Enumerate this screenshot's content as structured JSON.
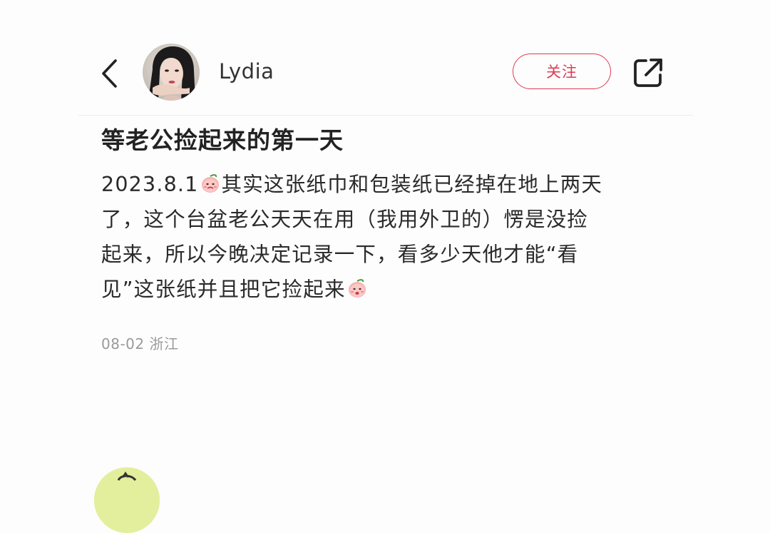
{
  "header": {
    "back_icon": "chevron-left-icon",
    "username": "Lydia",
    "follow_label": "关注",
    "share_icon": "share-external-icon"
  },
  "post": {
    "title": "等老公捡起来的第一天",
    "body_lines": [
      {
        "before": "2023.8.1",
        "emoji": "peach-face-emoji",
        "after": "其实这张纸巾和包装纸已经掉在地上两天"
      },
      {
        "text": "了，这个台盆老公天天在用（我用外卫的）愣是没捡"
      },
      {
        "text": "起来，所以今晚决定记录一下，看多少天他才能“看"
      },
      {
        "before": "见”这张纸并且把它捡起来",
        "emoji": "peach-face-emoji"
      }
    ],
    "meta": "08-02 浙江"
  },
  "colors": {
    "accent": "#e03a52",
    "meta_text": "#9a9a9a"
  }
}
